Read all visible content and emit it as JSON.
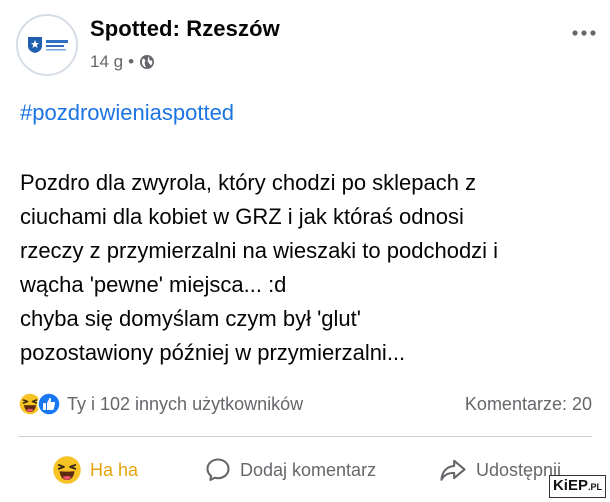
{
  "post": {
    "page_name": "Spotted: Rzeszów",
    "time": "14 g",
    "separator": "•",
    "more_icon": "more-horizontal-icon",
    "privacy_icon": "globe-icon",
    "hashtag": "#pozdrowieniaspotted",
    "lines": [
      "Pozdro dla zwyrola, który chodzi po sklepach z",
      "ciuchami dla kobiet w GRZ i jak któraś odnosi",
      "rzeczy z przymierzalni na wieszaki to podchodzi i",
      "wącha 'pewne' miejsca... :d",
      "chyba się domyślam czym był 'glut'",
      "pozostawiony później w przymierzalni..."
    ]
  },
  "reactions": {
    "summary": "Ty i 102 innych użytkowników",
    "comments": "Komentarze: 20",
    "icons": [
      "haha-emoji-icon",
      "like-icon"
    ]
  },
  "actions": {
    "haha": "Ha ha",
    "comment": "Dodaj komentarz",
    "share": "Udostępnij"
  },
  "watermark": {
    "main": "KiEP",
    "suffix": ".PL"
  },
  "colors": {
    "link": "#1b74e4",
    "secondary": "#65676b",
    "haha": "#e4a30a",
    "like": "#1877f2"
  }
}
